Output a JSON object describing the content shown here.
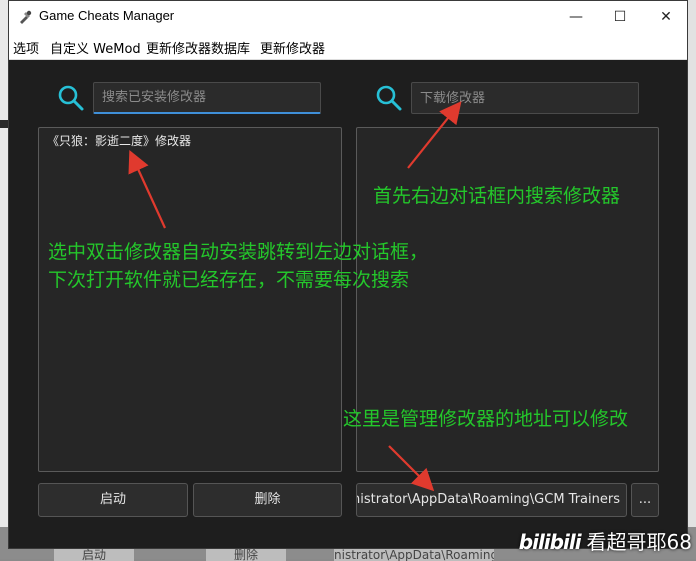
{
  "window": {
    "title": "Game Cheats Manager",
    "controls": {
      "minimize": "—",
      "maximize": "☐",
      "close": "✕"
    }
  },
  "menu": {
    "items": [
      "选项",
      "自定义 WeMod",
      "更新修改器数据库",
      "更新修改器"
    ]
  },
  "left_panel": {
    "search_placeholder": "搜索已安装修改器",
    "installed_trainers": [
      "《只狼：影逝二度》修改器"
    ],
    "launch_button": "启动",
    "delete_button": "删除"
  },
  "right_panel": {
    "search_placeholder": "下载修改器",
    "path_value": "C:\\Users\\Administrator\\AppData\\Roaming\\GCM Trainers",
    "browse_button": "..."
  },
  "annotations": {
    "search_tip": "首先右边对话框内搜索修改器",
    "install_tip_line1": "选中双击修改器自动安装跳转到左边对话框，",
    "install_tip_line2": "下次打开软件就已经存在，不需要每次搜索",
    "path_tip": "这里是管理修改器的地址可以修改"
  },
  "background": {
    "ghost_launch": "启动",
    "ghost_delete": "删除",
    "ghost_path": "nistrator\\AppData\\Roaming\\GCM Tr"
  },
  "watermark": {
    "logo": "bilibili",
    "text": "看超哥耶68"
  },
  "colors": {
    "accent_cyan": "#27c0d6",
    "annotation_green": "#24c72b",
    "arrow_red": "#e03a2e",
    "panel_bg": "#1e1e1e"
  }
}
